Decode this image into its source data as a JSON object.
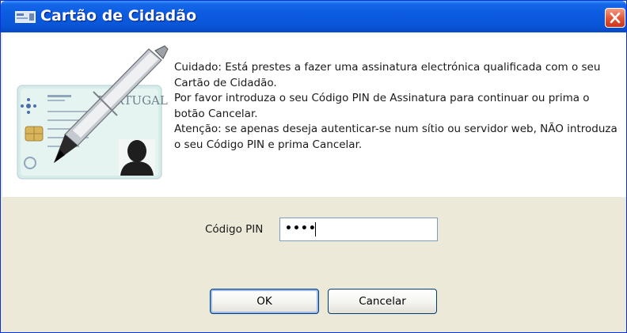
{
  "window": {
    "title": "Cartão de Cidadão"
  },
  "card": {
    "country_text": "PORTUGAL"
  },
  "message": {
    "line1": "Cuidado: Está prestes a fazer uma assinatura electrónica qualificada com o seu Cartão de Cidadão.",
    "line2": "Por favor introduza o seu Código PIN de Assinatura para continuar ou prima o botão Cancelar.",
    "line3": "Atenção: se apenas deseja autenticar-se num sítio ou servidor web, NÃO introduza o seu Código PIN e prima Cancelar."
  },
  "form": {
    "pin_label": "Código PIN",
    "pin_value": "••••"
  },
  "buttons": {
    "ok": "OK",
    "cancel": "Cancelar"
  },
  "colors": {
    "titlebar": "#0a57d9",
    "close": "#e4593a",
    "panel": "#ece9d8"
  },
  "icons": {
    "title": "card-icon",
    "close": "close-icon",
    "illustration": "card-signature-illustration"
  }
}
